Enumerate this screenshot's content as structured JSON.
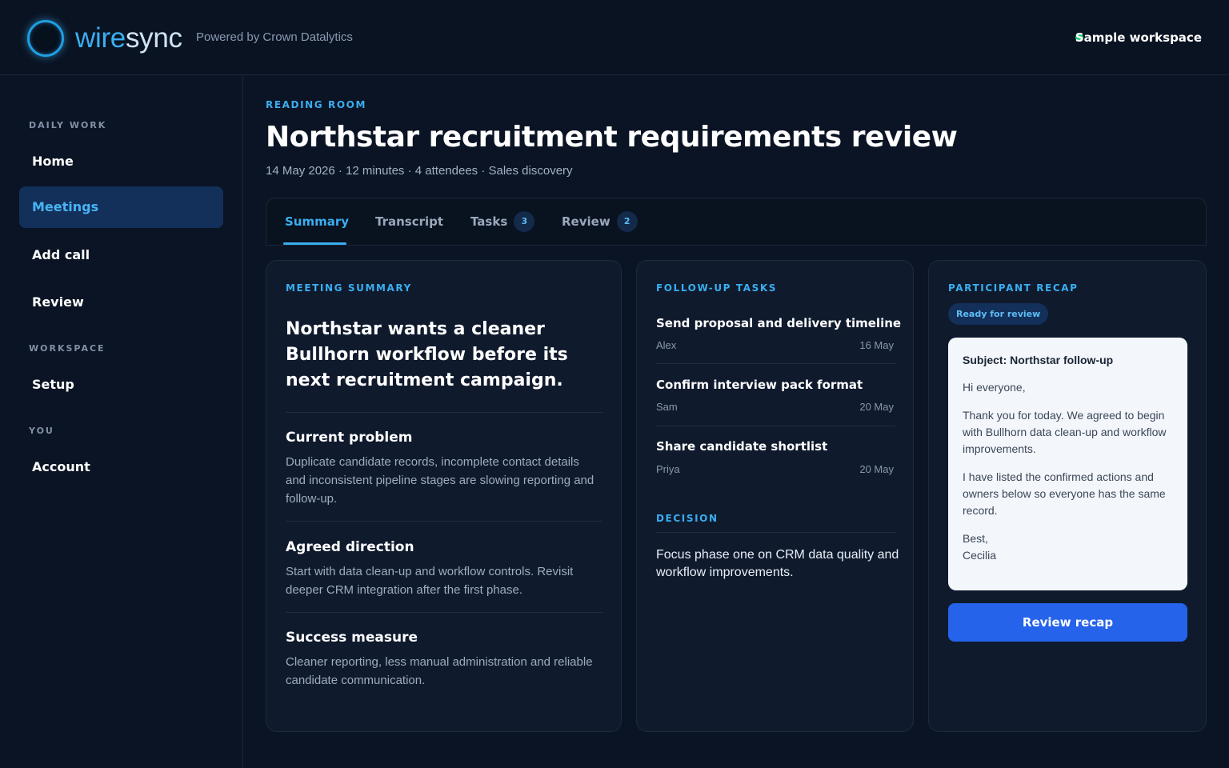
{
  "header": {
    "brand_part1": "wire",
    "brand_part2": "sync",
    "powered_by": "Powered by Crown Datalytics",
    "workspace_label": "Sample workspace",
    "workspace_status_color": "#22c47a"
  },
  "sidebar": {
    "sections": [
      {
        "heading": "DAILY WORK",
        "items": [
          "Home",
          "Meetings",
          "Add call",
          "Review"
        ]
      },
      {
        "heading": "WORKSPACE",
        "items": [
          "Setup"
        ]
      },
      {
        "heading": "YOU",
        "items": [
          "Account"
        ]
      }
    ],
    "active_item": "Meetings"
  },
  "page": {
    "eyebrow": "READING ROOM",
    "title": "Northstar recruitment requirements review",
    "meta": "14 May 2026 · 12 minutes · 4 attendees · Sales discovery"
  },
  "tabs": [
    {
      "label": "Summary",
      "active": true
    },
    {
      "label": "Transcript"
    },
    {
      "label": "Tasks",
      "badge": "3"
    },
    {
      "label": "Review",
      "badge": "2"
    }
  ],
  "summary": {
    "heading": "MEETING SUMMARY",
    "lead": "Northstar wants a cleaner Bullhorn workflow before its next recruitment campaign.",
    "sections": [
      {
        "title": "Current problem",
        "body": "Duplicate candidate records, incomplete contact details and inconsistent pipeline stages are slowing reporting and follow-up."
      },
      {
        "title": "Agreed direction",
        "body": "Start with data clean-up and workflow controls. Revisit deeper CRM integration after the first phase."
      },
      {
        "title": "Success measure",
        "body": "Cleaner reporting, less manual administration and reliable candidate communication."
      }
    ]
  },
  "tasks": {
    "heading": "FOLLOW-UP TASKS",
    "items": [
      {
        "title": "Send proposal and delivery timeline",
        "owner": "Alex",
        "date": "16 May"
      },
      {
        "title": "Confirm interview pack format",
        "owner": "Sam",
        "date": "20 May"
      },
      {
        "title": "Share candidate shortlist",
        "owner": "Priya",
        "date": "20 May"
      }
    ],
    "decision_heading": "DECISION",
    "decision_text": "Focus phase one on CRM data quality and workflow improvements."
  },
  "recap": {
    "heading": "PARTICIPANT RECAP",
    "status": "Ready for review",
    "email": {
      "subject": "Subject: Northstar follow-up",
      "greeting": "Hi everyone,",
      "para1": "Thank you for today. We agreed to begin with Bullhorn data clean-up and workflow improvements.",
      "para2": "I have listed the confirmed actions and owners below so everyone has the same record.",
      "signoff": "Best,",
      "name": "Cecilia"
    },
    "button_label": "Review recap"
  },
  "colors": {
    "accent": "#3aaef0",
    "primary_button": "#2563eb",
    "background": "#0b1424"
  }
}
